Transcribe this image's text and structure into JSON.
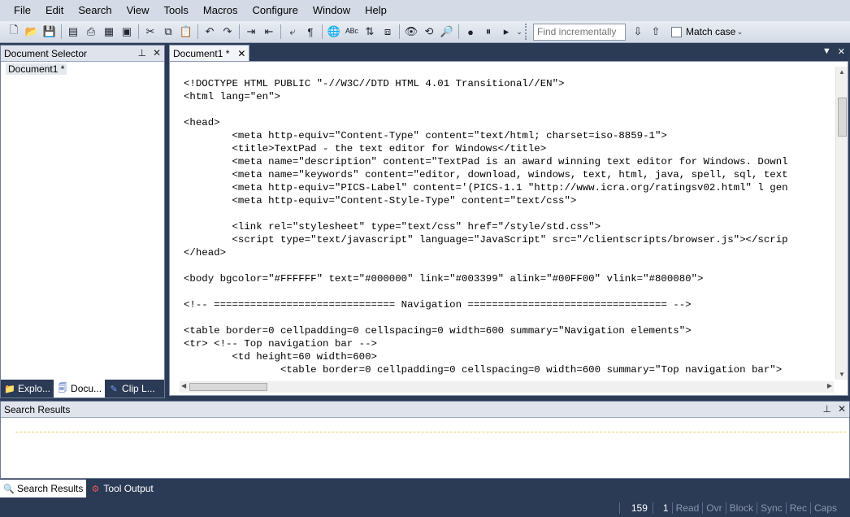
{
  "menu": [
    "File",
    "Edit",
    "Search",
    "View",
    "Tools",
    "Macros",
    "Configure",
    "Window",
    "Help"
  ],
  "toolbar": {
    "find_placeholder": "Find incrementally",
    "match_case_label": "Match case"
  },
  "document_selector": {
    "title": "Document Selector",
    "item": "Document1 *",
    "tabs": [
      "Explo...",
      "Docu...",
      "Clip L..."
    ]
  },
  "editor": {
    "tab_label": "Document1 *",
    "lines": [
      "<!DOCTYPE HTML PUBLIC \"-//W3C//DTD HTML 4.01 Transitional//EN\">",
      "<html lang=\"en\">",
      "",
      "<head>",
      "        <meta http-equiv=\"Content-Type\" content=\"text/html; charset=iso-8859-1\">",
      "        <title>TextPad - the text editor for Windows</title>",
      "        <meta name=\"description\" content=\"TextPad is an award winning text editor for Windows. Downl",
      "        <meta name=\"keywords\" content=\"editor, download, windows, text, html, java, spell, sql, text",
      "        <meta http-equiv=\"PICS-Label\" content='(PICS-1.1 \"http://www.icra.org/ratingsv02.html\" l gen",
      "        <meta http-equiv=\"Content-Style-Type\" content=\"text/css\">",
      "",
      "        <link rel=\"stylesheet\" type=\"text/css\" href=\"/style/std.css\">",
      "        <script type=\"text/javascript\" language=\"JavaScript\" src=\"/clientscripts/browser.js\"></scrip",
      "</head>",
      "",
      "<body bgcolor=\"#FFFFFF\" text=\"#000000\" link=\"#003399\" alink=\"#00FF00\" vlink=\"#800080\">",
      "",
      "<!-- ============================== Navigation ================================= -->",
      "",
      "<table border=0 cellpadding=0 cellspacing=0 width=600 summary=\"Navigation elements\">",
      "<tr> <!-- Top navigation bar -->",
      "        <td height=60 width=600>",
      "                <table border=0 cellpadding=0 cellspacing=0 width=600 summary=\"Top navigation bar\">"
    ]
  },
  "search_results": {
    "title": "Search Results"
  },
  "bottom_tabs": [
    "Search Results",
    "Tool Output"
  ],
  "status": {
    "line": "159",
    "col": "1",
    "flags": [
      "Read",
      "Ovr",
      "Block",
      "Sync",
      "Rec",
      "Caps"
    ]
  }
}
